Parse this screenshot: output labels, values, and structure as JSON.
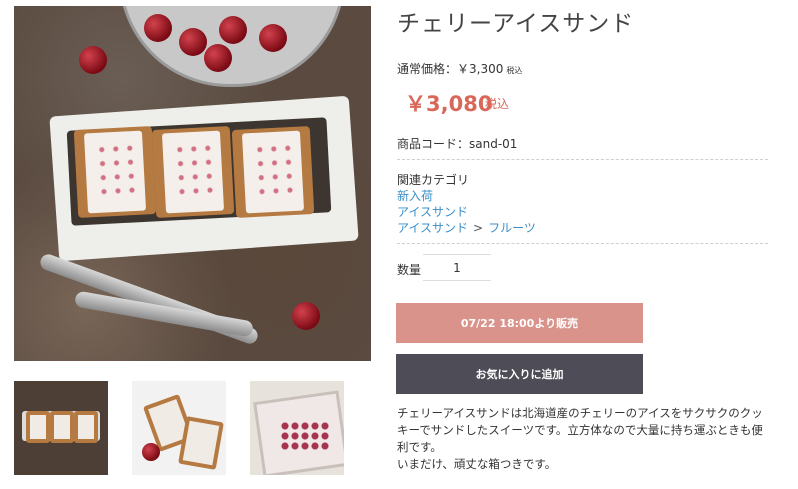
{
  "product": {
    "title": "チェリーアイスサンド",
    "regular_price_label": "通常価格：￥3,300",
    "regular_tax": "税込",
    "sale_price": "￥3,080",
    "sale_tax": "税込",
    "code_label": "商品コード：",
    "code_value": "sand-01"
  },
  "categories": {
    "label": "関連カテゴリ",
    "links": [
      "新入荷",
      "アイスサンド",
      "アイスサンド",
      "フルーツ"
    ],
    "separator": ">"
  },
  "quantity": {
    "label": "数量",
    "value": "1"
  },
  "buttons": {
    "sale_label": "07/22 18:00より販売",
    "favorite_label": "お気に入りに追加"
  },
  "description": {
    "line1": "チェリーアイスサンドは北海道産のチェリーのアイスをサクサクのクッキーでサンドしたスイーツです。立方体なので大量に持ち運ぶときも便利です。",
    "line2": "いまだけ、頑丈な箱つきです。"
  },
  "colors": {
    "sale_price": "#d9685a",
    "link": "#3a8fc9",
    "sale_button": "#d9938b",
    "favorite_button": "#4e4c56"
  }
}
